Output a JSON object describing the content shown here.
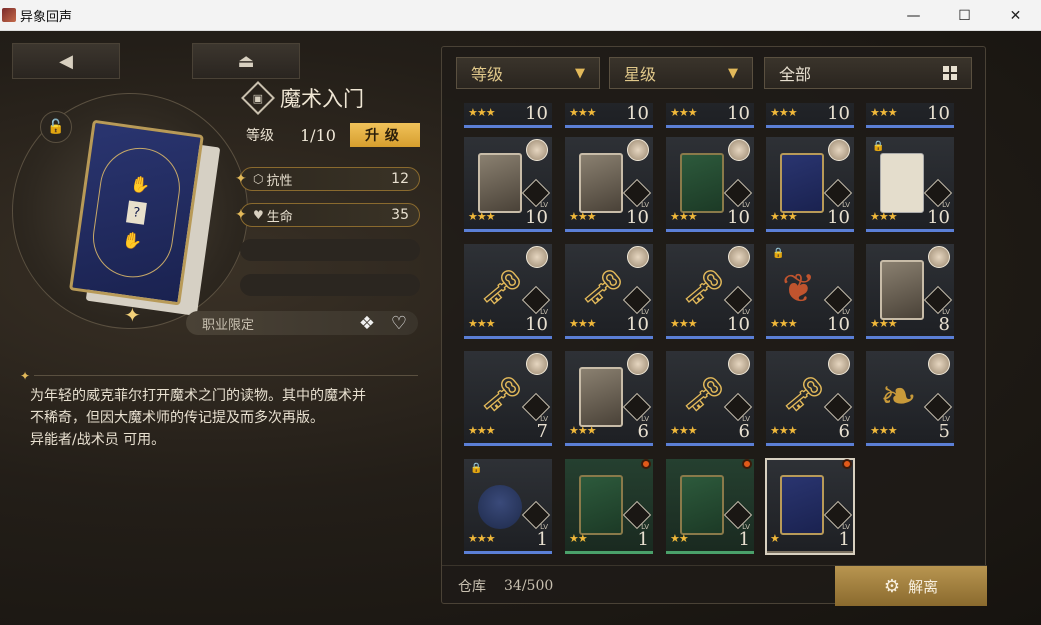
{
  "window": {
    "title": "异象回声",
    "minimize": "—",
    "maximize": "☐",
    "close": "✕"
  },
  "nav": {
    "back": "◀",
    "eject": "⏏"
  },
  "item": {
    "name": "魔术入门",
    "level_label": "等级",
    "level_value": "1/10",
    "upgrade_label": "升级",
    "stats": [
      {
        "icon": "resistance-icon",
        "label": "抗性",
        "value": "12"
      },
      {
        "icon": "heart-icon",
        "label": "生命",
        "value": "35"
      }
    ],
    "job_label": "职业限定",
    "description": [
      "为年轻的威克菲尔打开魔术之门的读物。其中的魔术并",
      "不稀奇，但因大魔术师的传记提及而多次再版。",
      "异能者/战术员 可用。"
    ]
  },
  "filters": {
    "level": "等级",
    "star": "星级",
    "all": "全部"
  },
  "inventory": {
    "row0": [
      {
        "lv": "10",
        "stars": "★★★"
      },
      {
        "lv": "10",
        "stars": "★★★"
      },
      {
        "lv": "10",
        "stars": "★★★"
      },
      {
        "lv": "10",
        "stars": "★★★"
      },
      {
        "lv": "10",
        "stars": "★★★"
      }
    ],
    "row1": [
      {
        "lv": "10",
        "stars": "★★★"
      },
      {
        "lv": "10",
        "stars": "★★★"
      },
      {
        "lv": "10",
        "stars": "★★★"
      },
      {
        "lv": "10",
        "stars": "★★★"
      },
      {
        "lv": "10",
        "stars": "★★★"
      }
    ],
    "row2": [
      {
        "lv": "10",
        "stars": "★★★"
      },
      {
        "lv": "10",
        "stars": "★★★"
      },
      {
        "lv": "10",
        "stars": "★★★"
      },
      {
        "lv": "10",
        "stars": "★★★"
      },
      {
        "lv": "8",
        "stars": "★★★"
      }
    ],
    "row3": [
      {
        "lv": "7",
        "stars": "★★★"
      },
      {
        "lv": "6",
        "stars": "★★★"
      },
      {
        "lv": "6",
        "stars": "★★★"
      },
      {
        "lv": "6",
        "stars": "★★★"
      },
      {
        "lv": "5",
        "stars": "★★★"
      }
    ],
    "row4": [
      {
        "lv": "1",
        "stars": "★★★"
      },
      {
        "lv": "1",
        "stars": "★★"
      },
      {
        "lv": "1",
        "stars": "★★"
      },
      {
        "lv": "1",
        "stars": "★"
      }
    ],
    "lv_tag": "LV",
    "warehouse_label": "仓库",
    "warehouse_count": "34/500",
    "dismantle_label": "解离"
  },
  "colors": {
    "accent_gold": "#e2b95a",
    "rarity_blue": "#5b7fd6",
    "rarity_green": "#4aa06a",
    "new_dot": "#e25a1a"
  }
}
